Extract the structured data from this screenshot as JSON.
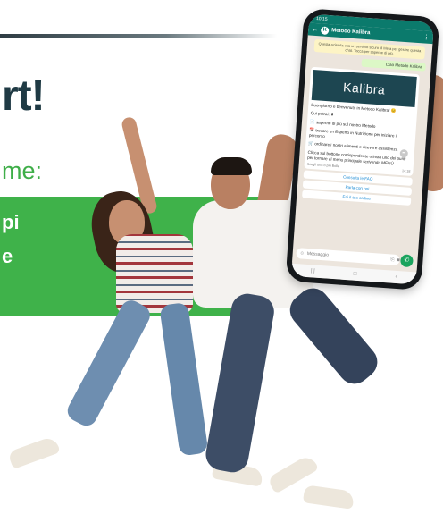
{
  "hero": {
    "headline": "rt!",
    "subline": "me:",
    "band_line1": "pi",
    "band_line2": "e"
  },
  "phone": {
    "status_time": "10:15",
    "chat_name": "Metodo Kalibra",
    "chat_avatar_letter": "K",
    "notice": "Questa azienda usa un servizio sicuro di Meta per gestire questa chat. Tocca per saperne di più.",
    "outgoing_message": "Ciao Metodo Kalibra",
    "banner_logo": "Kalibra",
    "message_intro": "Buongiorno e benvenuto in Metodo Kalibra! 😊",
    "message_can": "Qui potrai: ⬇",
    "message_opt1": "📄 saperne di più sul nostro Metodo",
    "message_opt2": "📅 trovare un Esperto in Nutrizione per iniziare il percorso",
    "message_opt3": "🛒 ordinare i nostri alimenti e ricevere assistenza",
    "message_cta": "Clicca sul bottone corrispondente o invia uno dei punti per tornare al menu principale scrivendo MENÙ",
    "message_footer": "Scegli una o più Bolle",
    "message_time": "14:18",
    "button1": "Consulta le FAQ",
    "button2": "Parla con noi",
    "button3": "Fai il tuo ordine",
    "input_placeholder": "Messaggio",
    "mic_icon_glyph": "✆"
  },
  "colors": {
    "brand_dark": "#1f3a44",
    "brand_green": "#3fb24a",
    "whatsapp_teal": "#0b7a6c",
    "kalibra_banner": "#1d4651",
    "link_blue": "#1b8ad3"
  },
  "icons": [
    "back-arrow-icon",
    "menu-dots-icon",
    "emoji-icon",
    "attach-icon",
    "camera-icon",
    "mic-icon",
    "forward-icon"
  ]
}
